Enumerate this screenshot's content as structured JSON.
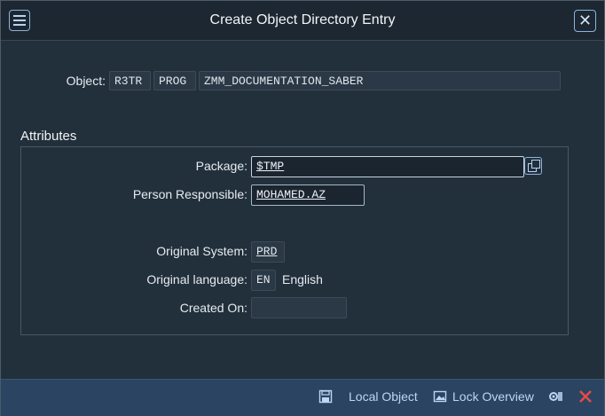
{
  "dialog": {
    "title": "Create Object Directory Entry",
    "close_symbol": "✕"
  },
  "object": {
    "label": "Object:",
    "pgmid": "R3TR",
    "type": "PROG",
    "name": "ZMM_DOCUMENTATION_SABER"
  },
  "attributes": {
    "title": "Attributes",
    "package_label": "Package:",
    "package_value": "$TMP",
    "person_label": "Person Responsible:",
    "person_value": "MOHAMED.AZ",
    "orig_system_label": "Original System:",
    "orig_system_value": "PRD",
    "orig_lang_label": "Original language:",
    "orig_lang_code": "EN",
    "orig_lang_text": "English",
    "created_on_label": "Created On:",
    "created_on_value": ""
  },
  "footer": {
    "local_object_label": "Local Object",
    "lock_overview_label": "Lock Overview"
  },
  "icons": [
    "menu-icon",
    "close-icon",
    "value-help-icon",
    "save-icon",
    "image-icon",
    "settings-icon",
    "cancel-icon"
  ],
  "colors": {
    "background": "#22303c",
    "footer": "#2a4462",
    "accent": "#8ab4e0",
    "cancel": "#e34b4b"
  }
}
